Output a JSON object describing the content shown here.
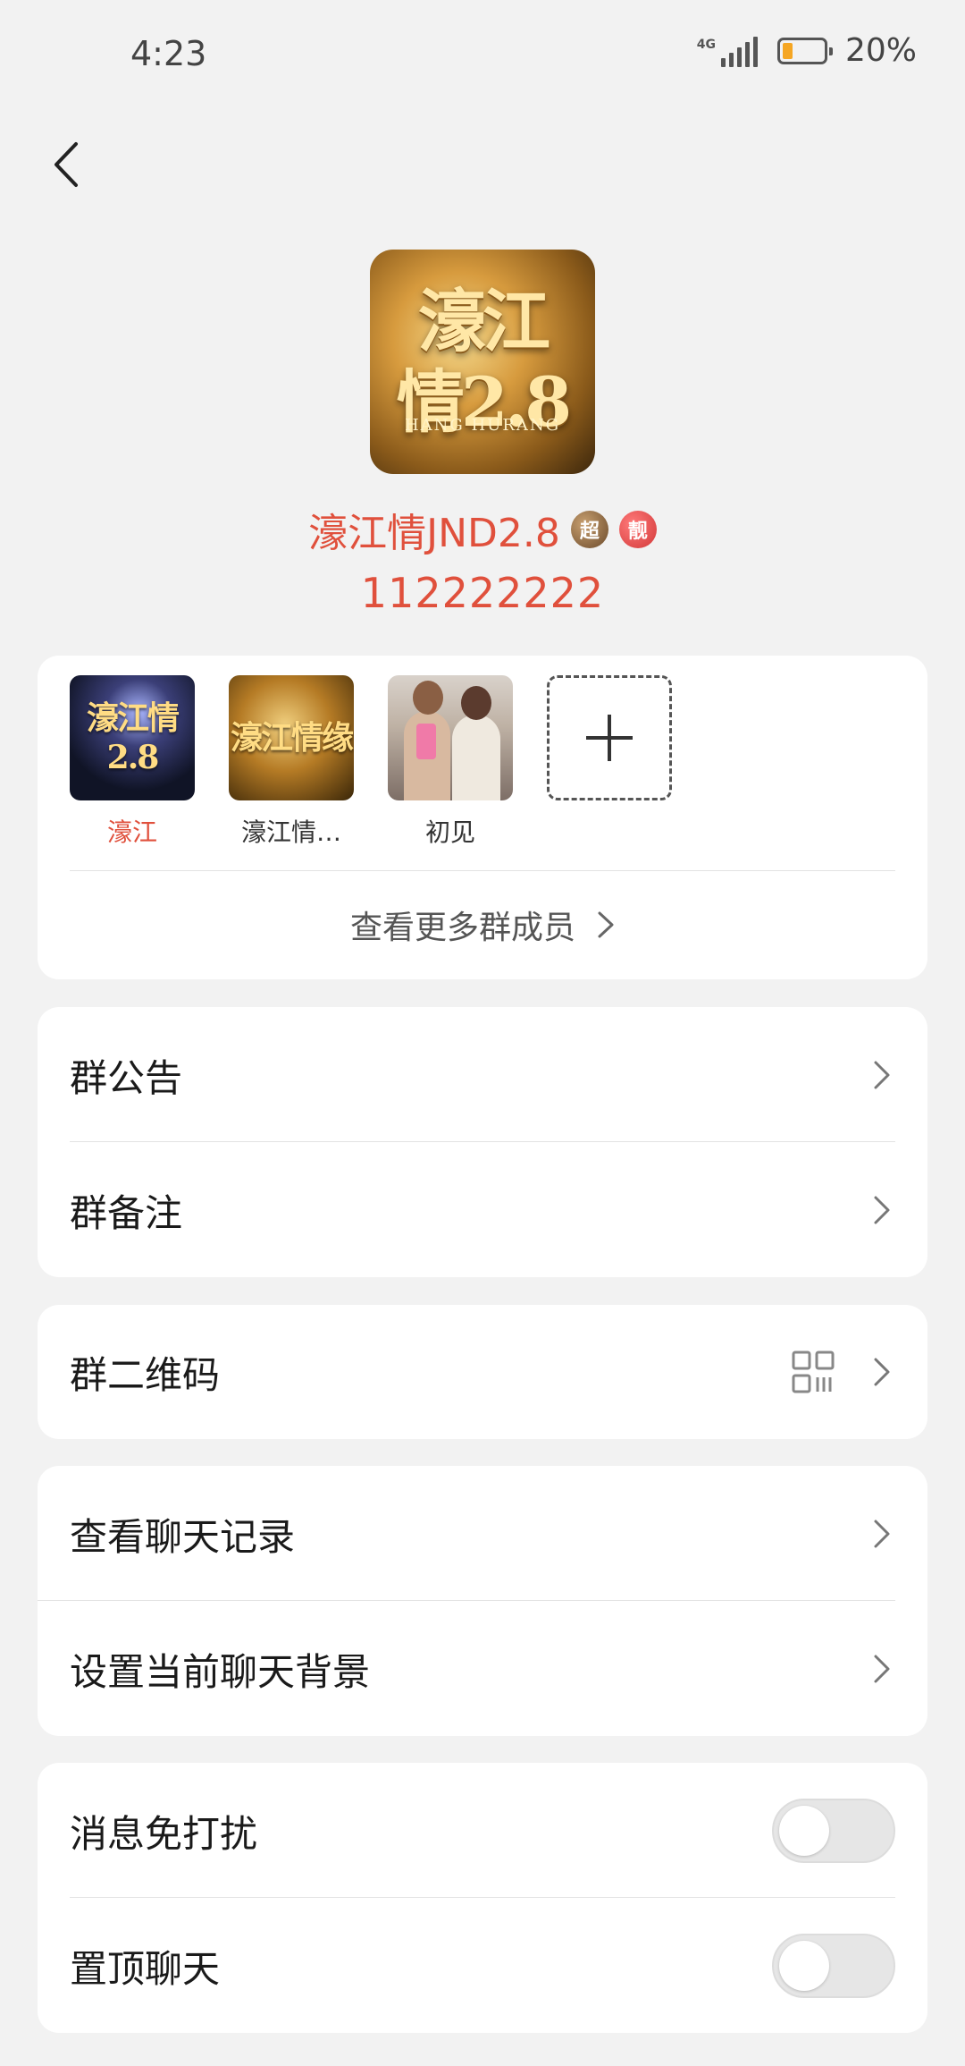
{
  "status_bar": {
    "time": "4:23",
    "network": "4G",
    "battery_percent": "20%",
    "battery_level": 0.2
  },
  "group": {
    "avatar_text_line1": "濠江",
    "avatar_text_line2": "情2.8",
    "avatar_caption": "HANG HURANG",
    "name": "濠江情JND2.8",
    "badge_super": "超",
    "badge_pretty": "靓",
    "id": "112222222"
  },
  "members": [
    {
      "name": "濠江",
      "avatar_text": "濠江情2.8"
    },
    {
      "name": "濠江情…",
      "avatar_text": "濠江情缘"
    },
    {
      "name": "初见",
      "avatar_text": ""
    }
  ],
  "more_members_label": "查看更多群成员",
  "menu": {
    "announcement": "群公告",
    "remark": "群备注",
    "qr_code": "群二维码",
    "chat_history": "查看聊天记录",
    "chat_background": "设置当前聊天背景",
    "do_not_disturb": "消息免打扰",
    "pin_chat": "置顶聊天"
  },
  "toggles": {
    "do_not_disturb": false,
    "pin_chat": false
  },
  "colors": {
    "accent_red": "#e0503c",
    "background": "#f2f2f2",
    "battery_orange": "#f5a623"
  }
}
